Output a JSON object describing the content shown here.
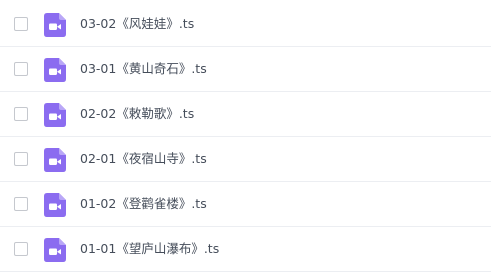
{
  "colors": {
    "icon_accent": "#8b6cf0",
    "text": "#454d5a",
    "divider": "#eceef2"
  },
  "file_icon": "video-file-icon",
  "files": [
    {
      "name": "03-02《风娃娃》.ts"
    },
    {
      "name": "03-01《黄山奇石》.ts"
    },
    {
      "name": "02-02《敕勒歌》.ts"
    },
    {
      "name": "02-01《夜宿山寺》.ts"
    },
    {
      "name": "01-02《登鹳雀楼》.ts"
    },
    {
      "name": "01-01《望庐山瀑布》.ts"
    }
  ]
}
